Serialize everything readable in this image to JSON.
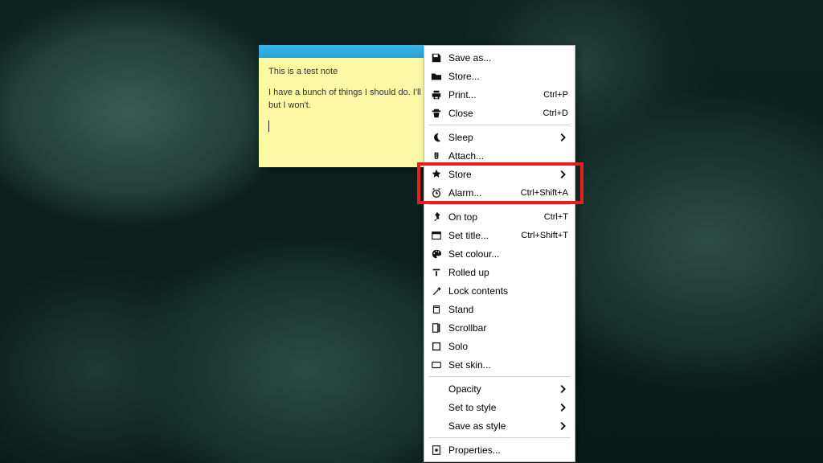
{
  "note": {
    "close": "×",
    "title_line": "This is a test note",
    "body_line": "I have a bunch of things I should do. I'll list them. I should, but I won't."
  },
  "menu": {
    "groups": [
      [
        {
          "id": "save-as",
          "icon": "save",
          "label": "Save as...",
          "shortcut": "",
          "submenu": false
        },
        {
          "id": "store",
          "icon": "folder",
          "label": "Store...",
          "shortcut": "",
          "submenu": false
        },
        {
          "id": "print",
          "icon": "print",
          "label": "Print...",
          "shortcut": "Ctrl+P",
          "submenu": false
        },
        {
          "id": "close",
          "icon": "trash",
          "label": "Close",
          "shortcut": "Ctrl+D",
          "submenu": false
        }
      ],
      [
        {
          "id": "sleep",
          "icon": "sleep",
          "label": "Sleep",
          "shortcut": "",
          "submenu": true
        },
        {
          "id": "attach",
          "icon": "attach",
          "label": "Attach...",
          "shortcut": "",
          "submenu": false
        },
        {
          "id": "store2",
          "icon": "star",
          "label": "Store",
          "shortcut": "",
          "submenu": true
        },
        {
          "id": "alarm",
          "icon": "alarm",
          "label": "Alarm...",
          "shortcut": "Ctrl+Shift+A",
          "submenu": false
        }
      ],
      [
        {
          "id": "on-top",
          "icon": "pin",
          "label": "On top",
          "shortcut": "Ctrl+T",
          "submenu": false
        },
        {
          "id": "set-title",
          "icon": "titlebar",
          "label": "Set title...",
          "shortcut": "Ctrl+Shift+T",
          "submenu": false
        },
        {
          "id": "set-colour",
          "icon": "palette",
          "label": "Set colour...",
          "shortcut": "",
          "submenu": false
        },
        {
          "id": "rolled-up",
          "icon": "rollup",
          "label": "Rolled up",
          "shortcut": "",
          "submenu": false
        },
        {
          "id": "lock",
          "icon": "wand",
          "label": "Lock contents",
          "shortcut": "",
          "submenu": false
        },
        {
          "id": "stand",
          "icon": "stand",
          "label": "Stand",
          "shortcut": "",
          "submenu": false
        },
        {
          "id": "scrollbar",
          "icon": "scroll",
          "label": "Scrollbar",
          "shortcut": "",
          "submenu": false
        },
        {
          "id": "solo",
          "icon": "solo",
          "label": "Solo",
          "shortcut": "",
          "submenu": false
        },
        {
          "id": "set-skin",
          "icon": "skin",
          "label": "Set skin...",
          "shortcut": "",
          "submenu": false
        }
      ],
      [
        {
          "id": "opacity",
          "icon": "",
          "label": "Opacity",
          "shortcut": "",
          "submenu": true
        },
        {
          "id": "set-to-style",
          "icon": "",
          "label": "Set to style",
          "shortcut": "",
          "submenu": true
        },
        {
          "id": "save-as-style",
          "icon": "",
          "label": "Save as style",
          "shortcut": "",
          "submenu": true
        }
      ],
      [
        {
          "id": "properties",
          "icon": "props",
          "label": "Properties...",
          "shortcut": "",
          "submenu": false
        }
      ]
    ]
  },
  "highlight_target": "alarm"
}
